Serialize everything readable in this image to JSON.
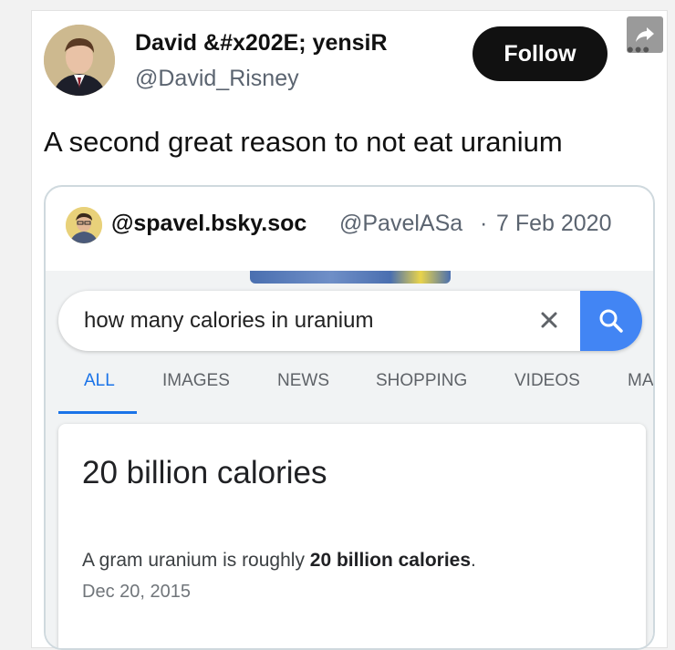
{
  "tweet": {
    "display_name": "David &#x202E; yensiR",
    "handle": "@David_Risney",
    "follow_label": "Follow",
    "more_label": "•••",
    "text": "A second great reason to not eat uranium"
  },
  "quoted_tweet": {
    "name": "@spavel.bsky.soc",
    "handle": "@PavelASa",
    "separator": "·",
    "date": "7 Feb 2020"
  },
  "google": {
    "query": "how many calories in uranium",
    "tabs": [
      {
        "label": "ALL",
        "active": true
      },
      {
        "label": "IMAGES",
        "active": false
      },
      {
        "label": "NEWS",
        "active": false
      },
      {
        "label": "SHOPPING",
        "active": false
      },
      {
        "label": "VIDEOS",
        "active": false
      },
      {
        "label": "MA",
        "active": false
      }
    ],
    "answer": "20 billion calories",
    "snippet_prefix": "A gram uranium is roughly ",
    "snippet_bold": "20 billion calories",
    "snippet_suffix": ".",
    "snippet_date": "Dec 20, 2015"
  },
  "colors": {
    "follow_bg": "#111111",
    "google_blue": "#4285f4",
    "active_tab": "#1a73e8"
  },
  "icons": [
    "share-icon",
    "more-icon",
    "close-icon",
    "search-icon"
  ]
}
